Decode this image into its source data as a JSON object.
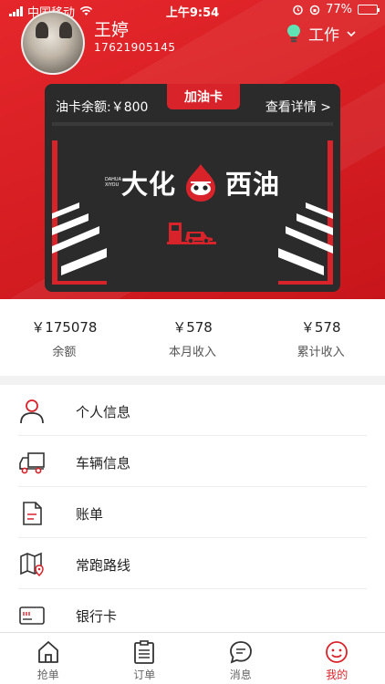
{
  "status_bar": {
    "carrier": "中国移动",
    "time": "上午9:54",
    "battery": "77%",
    "battery_level": 0.77
  },
  "profile": {
    "name": "王婷",
    "phone": "17621905145",
    "mode_label": "工作"
  },
  "card": {
    "tab_label": "加油卡",
    "balance_label": "油卡余额:￥800",
    "detail_link": "查看详情 >",
    "brand_left": "大化",
    "brand_right": "西油",
    "brand_small": "DAHUA XIYOU"
  },
  "stats": [
    {
      "value": "￥175078",
      "label": "余额"
    },
    {
      "value": "￥578",
      "label": "本月收入"
    },
    {
      "value": "￥578",
      "label": "累计收入"
    }
  ],
  "menu": [
    {
      "label": "个人信息",
      "icon": "person-icon"
    },
    {
      "label": "车辆信息",
      "icon": "truck-icon"
    },
    {
      "label": "账单",
      "icon": "document-icon"
    },
    {
      "label": "常跑路线",
      "icon": "map-route-icon"
    },
    {
      "label": "银行卡",
      "icon": "bank-card-icon"
    }
  ],
  "tabbar": [
    {
      "label": "抢单",
      "icon": "home-icon",
      "active": false
    },
    {
      "label": "订单",
      "icon": "clipboard-icon",
      "active": false
    },
    {
      "label": "消息",
      "icon": "message-icon",
      "active": false
    },
    {
      "label": "我的",
      "icon": "smiley-icon",
      "active": true
    }
  ],
  "colors": {
    "brand_red": "#d9232a",
    "card_dark": "#2b2b2b",
    "bulb_green": "#5fe3b5"
  }
}
